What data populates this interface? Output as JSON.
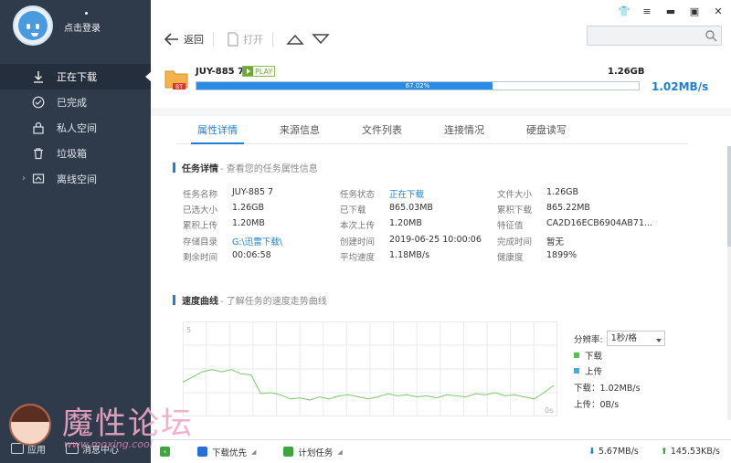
{
  "sidebar": {
    "login_label": "点击登录",
    "items": [
      {
        "label": "正在下载",
        "icon": "download-icon"
      },
      {
        "label": "已完成",
        "icon": "check-circle-icon"
      },
      {
        "label": "私人空间",
        "icon": "lock-icon"
      },
      {
        "label": "垃圾箱",
        "icon": "trash-icon"
      },
      {
        "label": "离线空间",
        "icon": "cloud-icon"
      }
    ],
    "bottom": {
      "app_label": "应用",
      "message_label": "消息中心"
    }
  },
  "toolbar": {
    "back_label": "返回",
    "open_label": "打开",
    "search_placeholder": ""
  },
  "task": {
    "name": "JUY-885 7",
    "badge": "PLAY",
    "file_tag": "BT",
    "size": "1.26GB",
    "progress_percent": 67.02,
    "progress_label": "67.02%",
    "speed": "1.02MB/s"
  },
  "tabs": [
    {
      "label": "属性详情",
      "active": true
    },
    {
      "label": "来源信息",
      "active": false
    },
    {
      "label": "文件列表",
      "active": false
    },
    {
      "label": "连接情况",
      "active": false
    },
    {
      "label": "硬盘读写",
      "active": false
    }
  ],
  "details_section": {
    "title": "任务详情",
    "subtitle": "- 查看您的任务属性信息"
  },
  "details": [
    [
      [
        "任务名称",
        "JUY-885 7",
        false
      ],
      [
        "任务状态",
        "正在下载",
        true
      ],
      [
        "文件大小",
        "1.26GB",
        false
      ]
    ],
    [
      [
        "已选大小",
        "1.26GB",
        false
      ],
      [
        "已下载",
        "865.03MB",
        false
      ],
      [
        "累积下载",
        "865.22MB",
        false
      ]
    ],
    [
      [
        "累积上传",
        "1.20MB",
        false
      ],
      [
        "本次上传",
        "1.20MB",
        false
      ],
      [
        "特征值",
        "CA2D16ECB6904AB71...",
        false
      ]
    ],
    [
      [
        "存储目录",
        "G:\\迅雷下载\\",
        true
      ],
      [
        "创建时间",
        "2019-06-25 10:00:06",
        false
      ],
      [
        "完成时间",
        "暂无",
        false
      ]
    ],
    [
      [
        "剩余时间",
        "00:06:58",
        false
      ],
      [
        "平均速度",
        "1.18MB/s",
        false
      ],
      [
        "健康度",
        "1899%",
        false
      ]
    ]
  ],
  "speed_section": {
    "title": "速度曲线",
    "subtitle": "- 了解任务的速度走势曲线"
  },
  "chart_data": {
    "type": "line",
    "y_top_label": "5",
    "y_right_label": "0s",
    "series": [
      {
        "name": "下载",
        "color": "#7dc96a",
        "values": [
          0.62,
          0.72,
          0.82,
          0.86,
          0.82,
          0.86,
          0.78,
          0.76,
          0.4,
          0.42,
          0.38,
          0.3,
          0.32,
          0.28,
          0.34,
          0.3,
          0.36,
          0.38,
          0.34,
          0.3,
          0.34,
          0.4,
          0.36,
          0.38,
          0.34,
          0.36,
          0.32,
          0.38,
          0.36,
          0.34,
          0.4,
          0.38,
          0.42,
          0.36,
          0.38,
          0.34,
          0.3,
          0.42,
          0.56
        ]
      },
      {
        "name": "上传",
        "color": "#4aa8dc",
        "values": []
      }
    ],
    "ylim": [
      0,
      5
    ],
    "grid": true
  },
  "chart_legend": {
    "resolution_label": "分辨率:",
    "resolution_value": "1秒/格",
    "download_label": "下载",
    "upload_label": "上传",
    "download_stat": "下载：1.02MB/s",
    "upload_stat": "上传：0B/s",
    "download_color": "#59c04c",
    "upload_color": "#4aa8dc"
  },
  "statusbar": {
    "download_priority": "下载优先",
    "scheduled_tasks": "计划任务",
    "down_speed": "5.67MB/s",
    "up_speed": "145.53KB/s"
  },
  "watermark": {
    "text": "魔性论坛",
    "url": "www.moxing.cool"
  }
}
